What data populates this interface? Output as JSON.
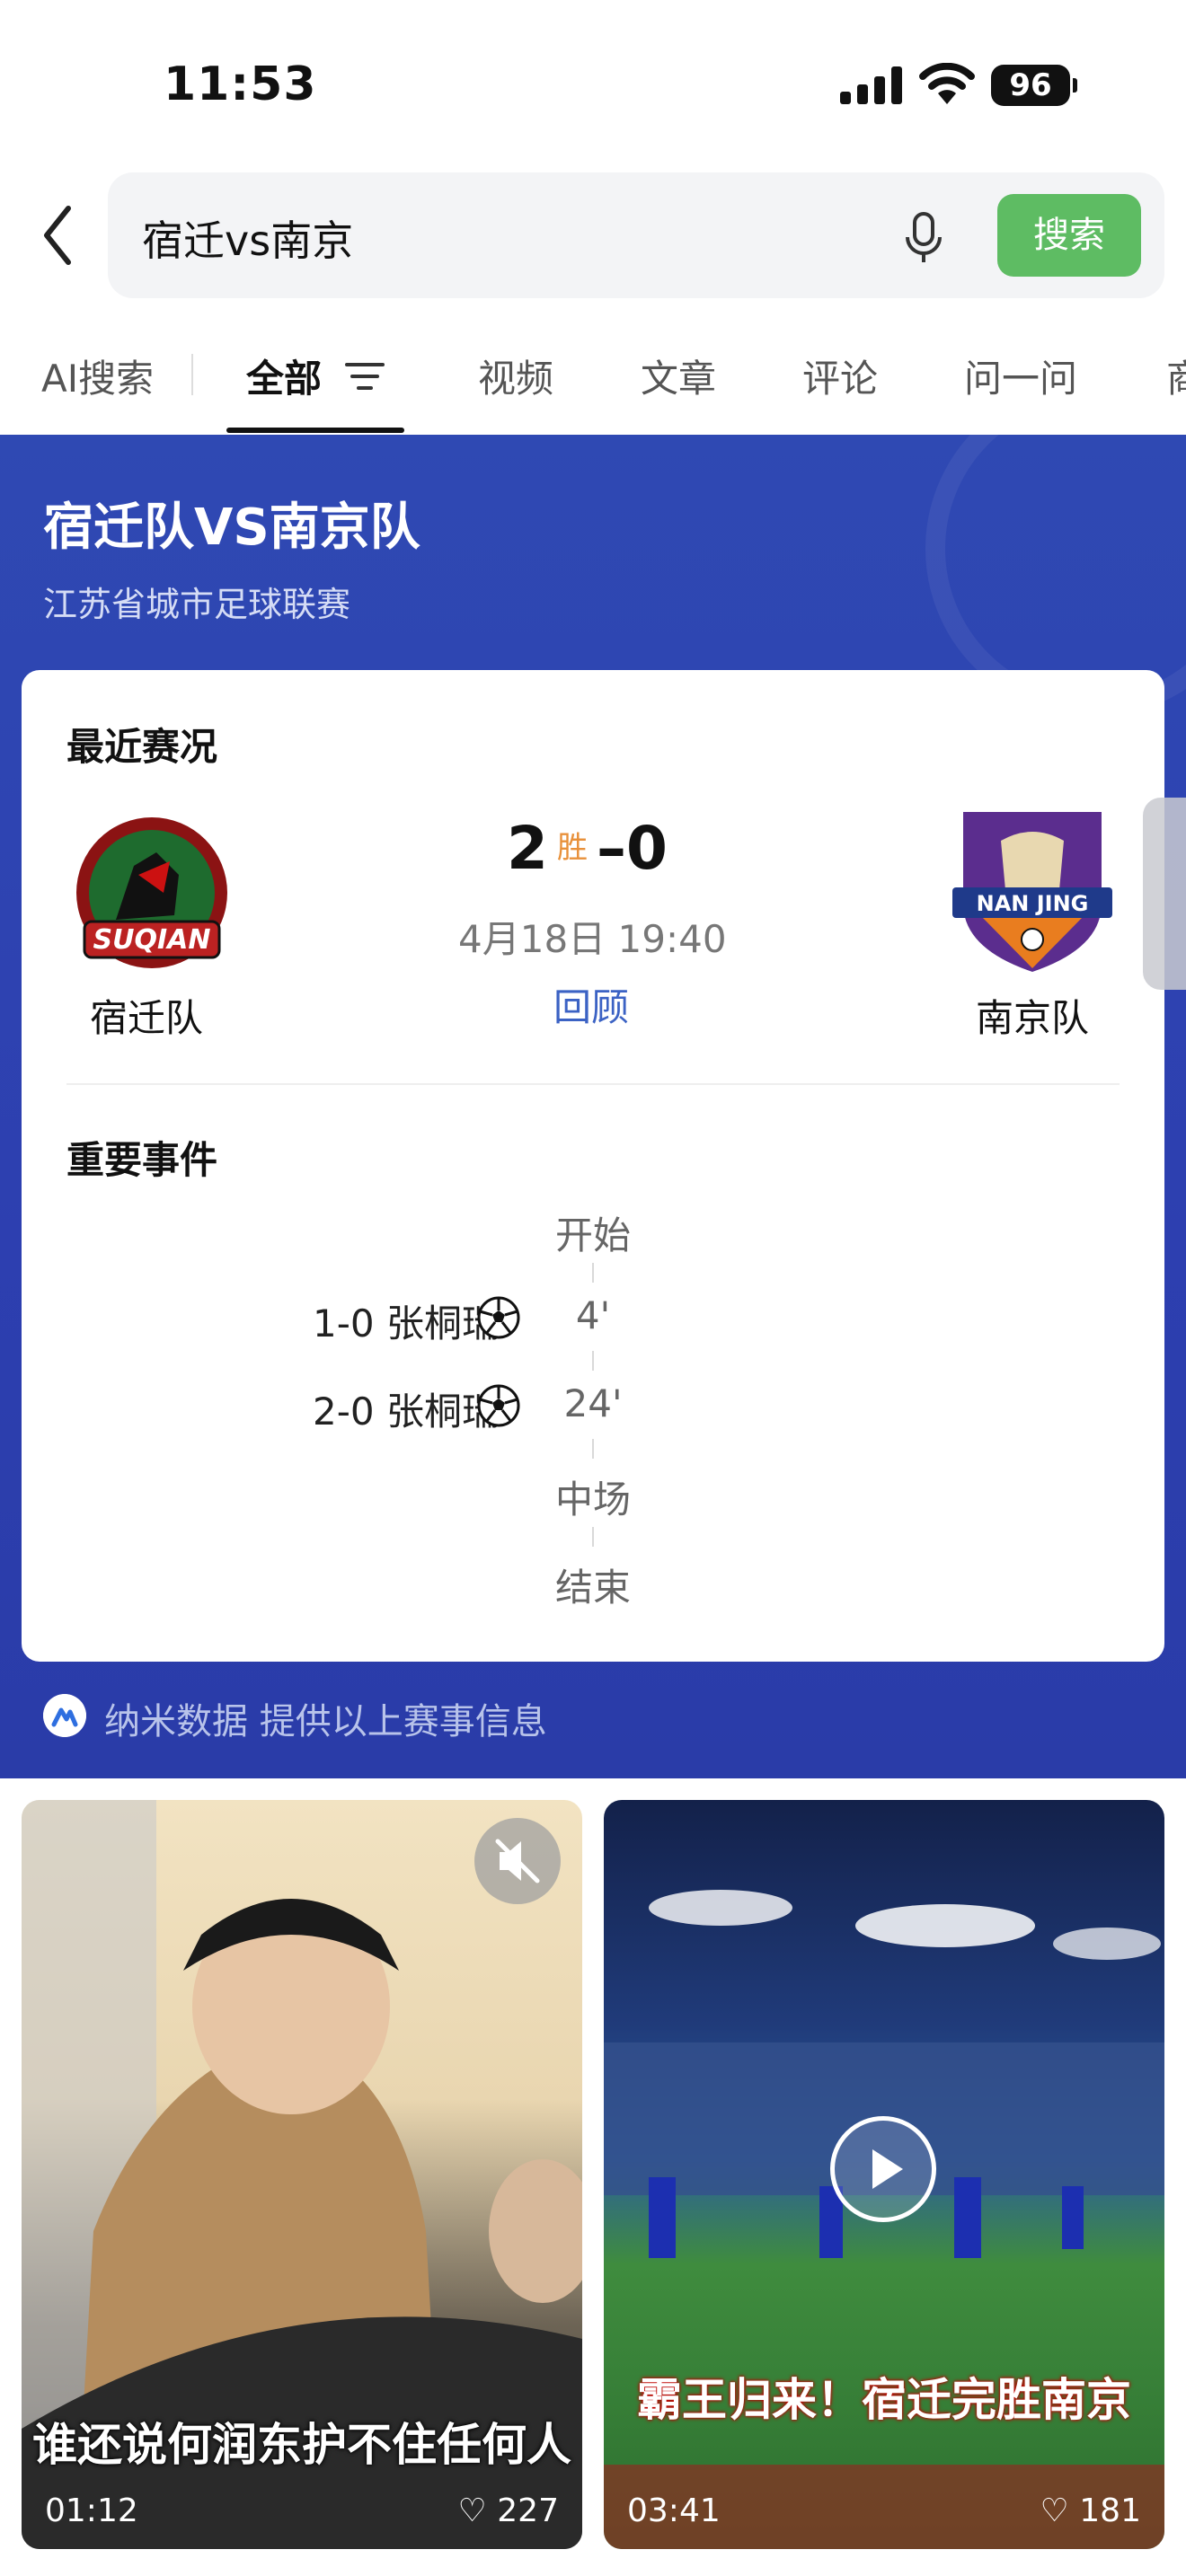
{
  "status": {
    "time": "11:53",
    "battery": "96"
  },
  "search": {
    "query": "宿迁vs南京",
    "button": "搜索"
  },
  "tabs": [
    "AI搜索",
    "全部",
    "视频",
    "文章",
    "评论",
    "问一问",
    "商"
  ],
  "match": {
    "title": "宿迁队VS南京队",
    "league": "江苏省城市足球联赛",
    "section_recent": "最近赛况",
    "home_team": "宿迁队",
    "away_team": "南京队",
    "home_score": "2",
    "away_score": "0",
    "result_badge": "胜",
    "dash": "–",
    "datetime": "4月18日 19:40",
    "review": "回顾",
    "section_events": "重要事件",
    "events": {
      "start": "开始",
      "goal1_score": "1-0 张桐瑞",
      "goal1_minute": "4'",
      "goal2_score": "2-0 张桐瑞",
      "goal2_minute": "24'",
      "halftime": "中场",
      "end": "结束"
    },
    "provider": "纳米数据  提供以上赛事信息"
  },
  "videos": [
    {
      "caption": "谁还说何润东护不住任何人",
      "duration": "01:12",
      "likes": "227"
    },
    {
      "caption": "霸王归来！宿迁完胜南京",
      "duration": "03:41",
      "likes": "181"
    }
  ],
  "colors": {
    "hero": "#2f49b3",
    "search_button": "#5ebc63",
    "win_badge": "#e8903a",
    "link": "#3b62c4"
  }
}
